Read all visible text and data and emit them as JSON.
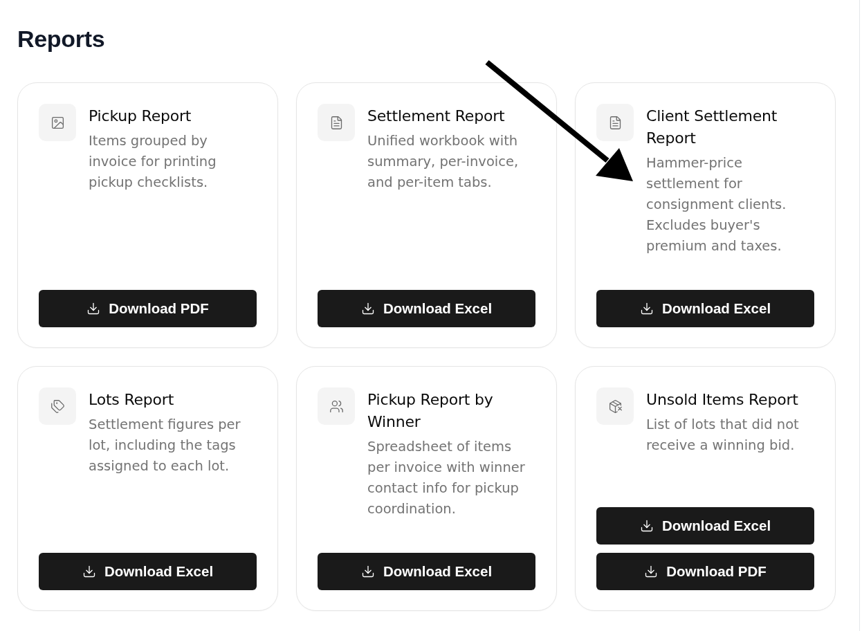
{
  "page": {
    "title": "Reports"
  },
  "reports": [
    {
      "title": "Pickup Report",
      "description": "Items grouped by invoice for printing pickup checklists.",
      "buttons": [
        "Download PDF"
      ]
    },
    {
      "title": "Settlement Report",
      "description": "Unified workbook with summary, per-invoice, and per-item tabs.",
      "buttons": [
        "Download Excel"
      ]
    },
    {
      "title": "Client Settlement Report",
      "description": "Hammer-price settlement for consignment clients. Excludes buyer's premium and taxes.",
      "buttons": [
        "Download Excel"
      ]
    },
    {
      "title": "Lots Report",
      "description": "Settlement figures per lot, including the tags assigned to each lot.",
      "buttons": [
        "Download Excel"
      ]
    },
    {
      "title": "Pickup Report by Winner",
      "description": "Spreadsheet of items per invoice with winner contact info for pickup coordination.",
      "buttons": [
        "Download Excel"
      ]
    },
    {
      "title": "Unsold Items Report",
      "description": "List of lots that did not receive a winning bid.",
      "buttons": [
        "Download Excel",
        "Download PDF"
      ]
    }
  ]
}
